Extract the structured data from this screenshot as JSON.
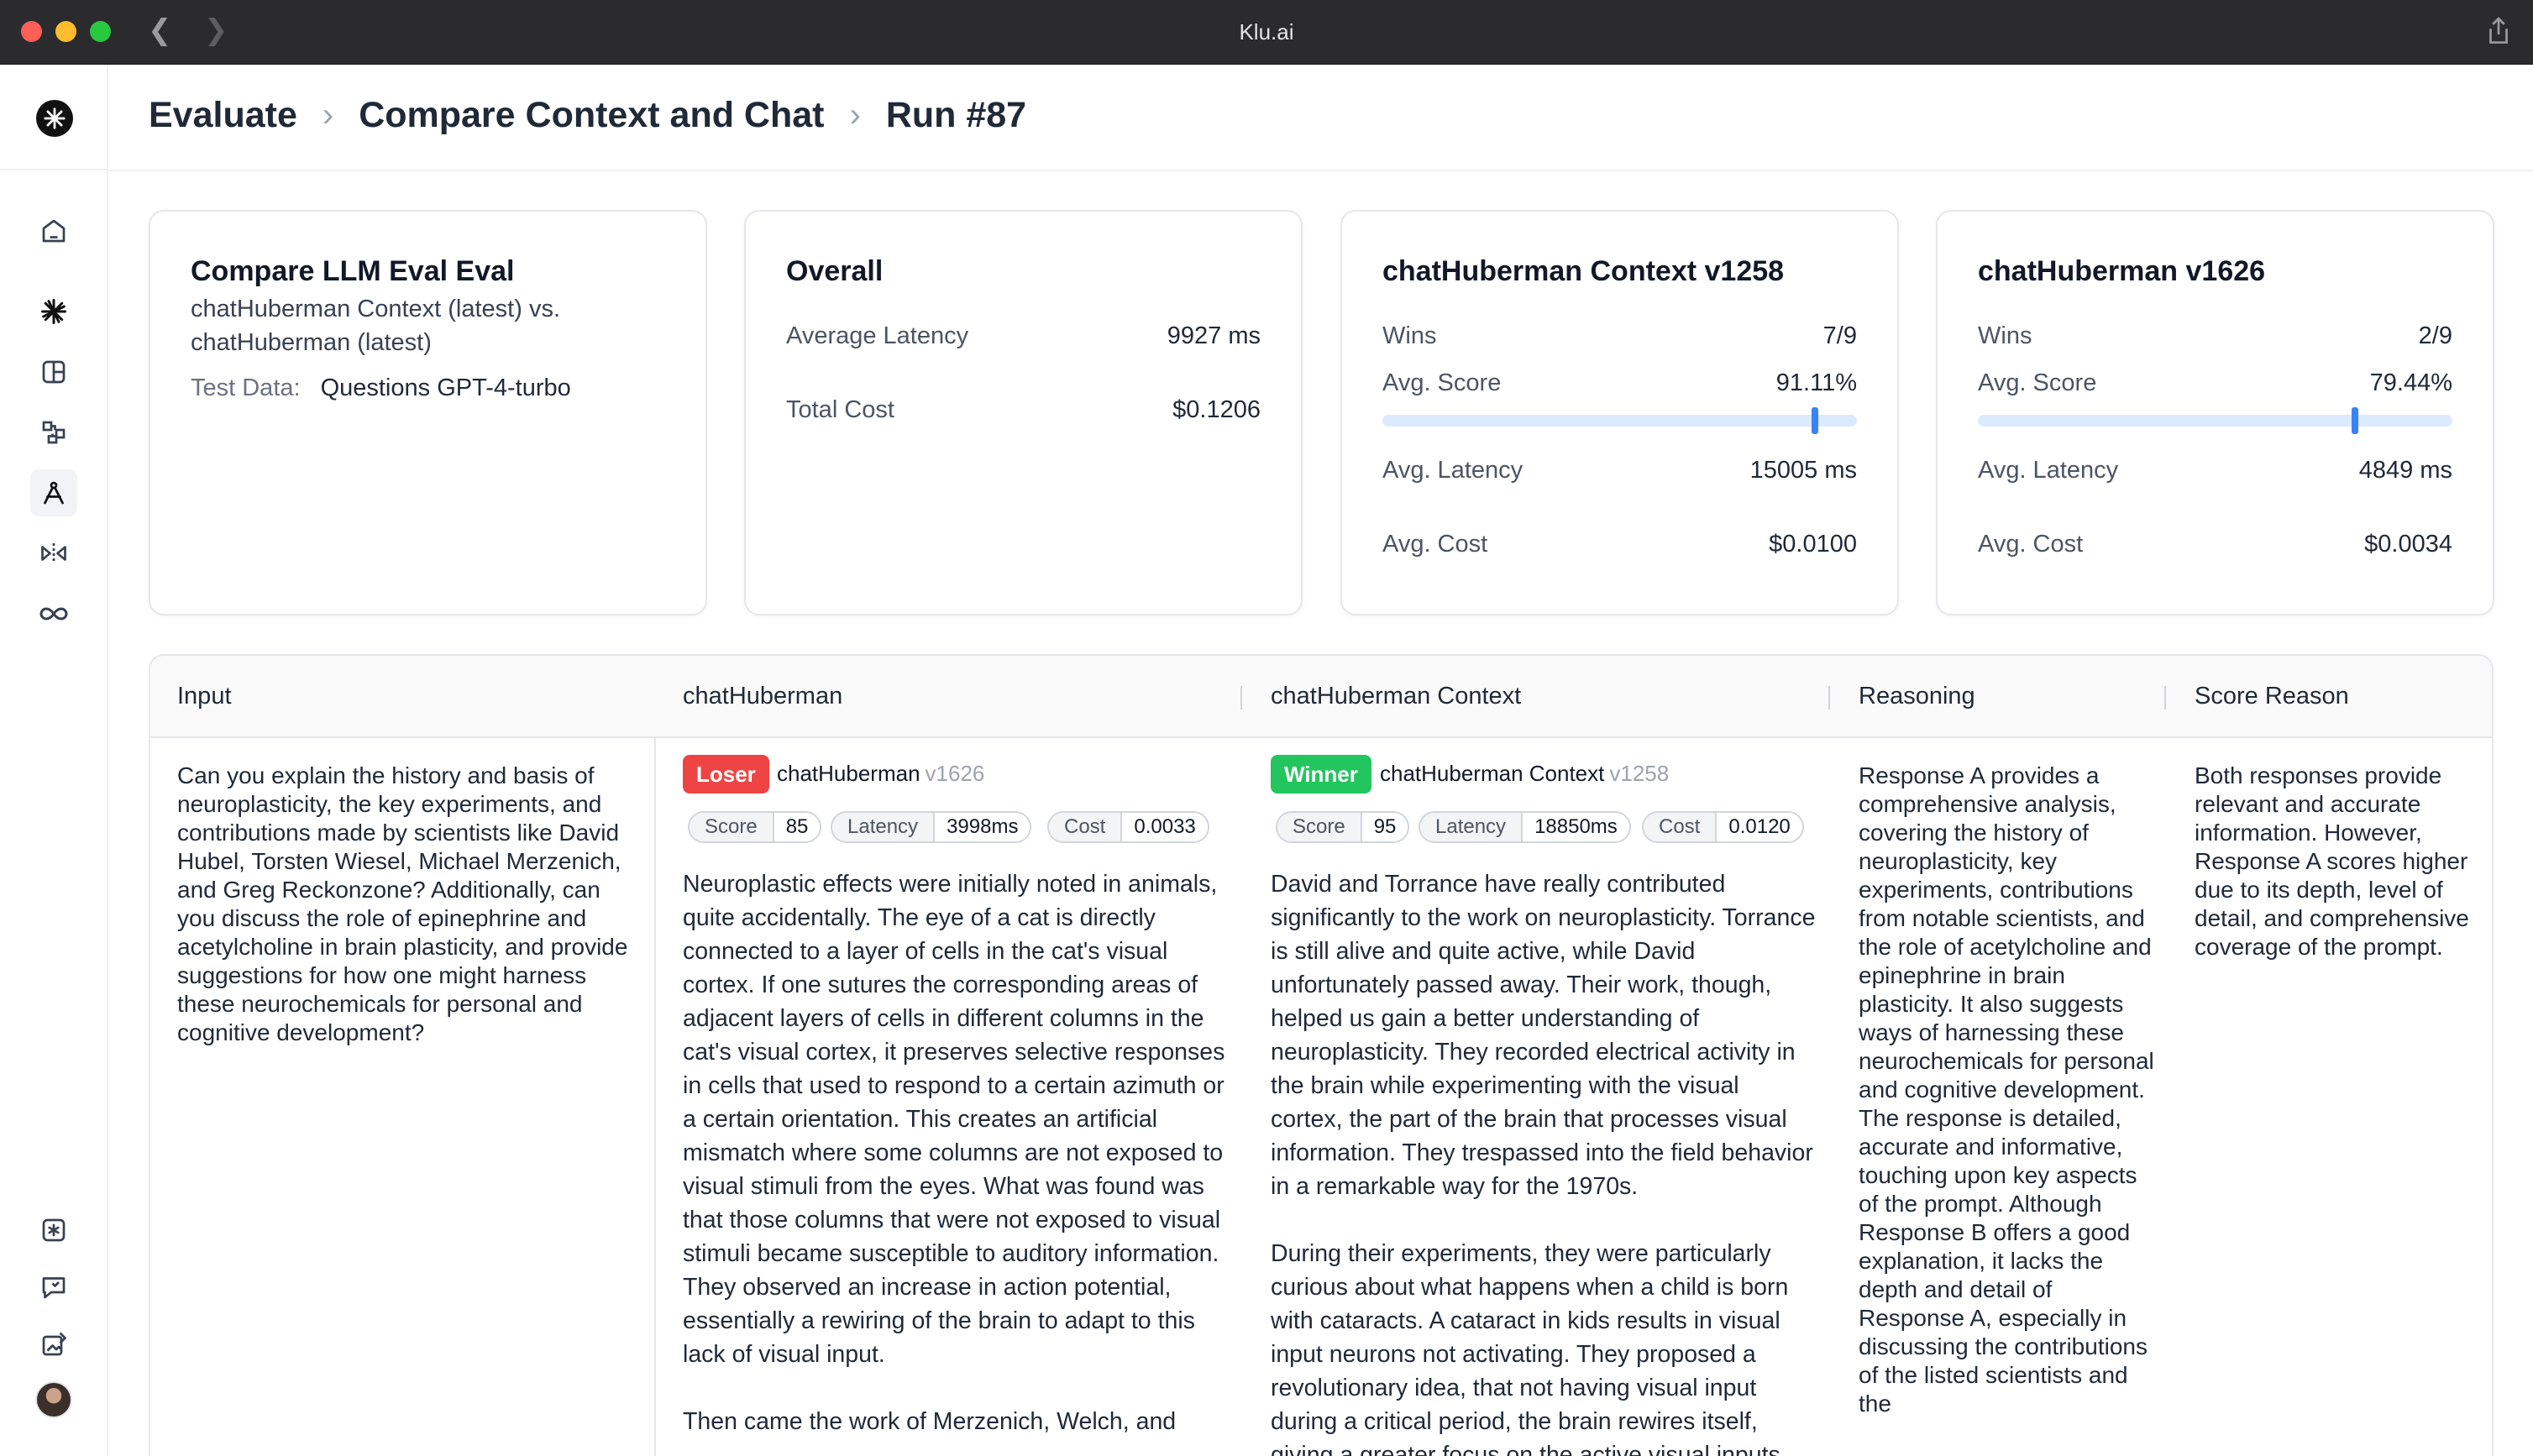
{
  "window": {
    "title": "Klu.ai"
  },
  "breadcrumb": [
    "Evaluate",
    "Compare Context and Chat",
    "Run #87"
  ],
  "cards": {
    "eval": {
      "title": "Compare LLM Eval Eval",
      "subtitle": "chatHuberman Context (latest) vs. chatHuberman (latest)",
      "test_data_label": "Test Data:",
      "test_data_value": "Questions GPT-4-turbo"
    },
    "overall": {
      "title": "Overall",
      "avg_latency_label": "Average Latency",
      "avg_latency_value": "9927 ms",
      "total_cost_label": "Total Cost",
      "total_cost_value": "$0.1206"
    },
    "context": {
      "title": "chatHuberman Context v1258",
      "wins_label": "Wins",
      "wins_value": "7/9",
      "score_label": "Avg. Score",
      "score_value": "91.11%",
      "score_fraction": 0.9111,
      "latency_label": "Avg. Latency",
      "latency_value": "15005 ms",
      "cost_label": "Avg. Cost",
      "cost_value": "$0.0100"
    },
    "chat": {
      "title": "chatHuberman v1626",
      "wins_label": "Wins",
      "wins_value": "2/9",
      "score_label": "Avg. Score",
      "score_value": "79.44%",
      "score_fraction": 0.7944,
      "latency_label": "Avg. Latency",
      "latency_value": "4849 ms",
      "cost_label": "Avg. Cost",
      "cost_value": "$0.0034"
    }
  },
  "table": {
    "headers": [
      "Input",
      "chatHuberman",
      "chatHuberman Context",
      "Reasoning",
      "Score Reason"
    ],
    "row": {
      "input": "Can you explain the history and basis of neuroplasticity, the key experiments, and contributions made by scientists like David Hubel, Torsten Wiesel, Michael Merzenich, and Greg Reckonzone? Additionally, can you discuss the role of epinephrine and acetylcholine in brain plasticity, and provide suggestions for how one might harness these neurochemicals for personal and cognitive development?",
      "chat": {
        "badge": "Loser",
        "model": "chatHuberman",
        "version": "v1626",
        "score_label": "Score",
        "score": "85",
        "latency_label": "Latency",
        "latency": "3998ms",
        "cost_label": "Cost",
        "cost": "0.0033",
        "response_p1": "Neuroplastic effects were initially noted in animals, quite accidentally. The eye of a cat is directly connected to a layer of cells in the cat's visual cortex. If one sutures the corresponding areas of adjacent layers of cells in different columns in the cat's visual cortex, it preserves selective responses in cells that used to respond to a certain azimuth or a certain orientation. This creates an artificial mismatch where some columns are not exposed to visual stimuli from the eyes. What was found was that those columns that were not exposed to visual stimuli became susceptible to auditory information. They observed an increase in action potential, essentially a rewiring of the brain to adapt to this lack of visual input.",
        "response_p2": "Then came the work of Merzenich, Welch, and"
      },
      "context": {
        "badge": "Winner",
        "model": "chatHuberman Context",
        "version": "v1258",
        "score_label": "Score",
        "score": "95",
        "latency_label": "Latency",
        "latency": "18850ms",
        "cost_label": "Cost",
        "cost": "0.0120",
        "response_p1": "David and Torrance have really contributed significantly to the work on neuroplasticity. Torrance is still alive and quite active, while David unfortunately passed away. Their work, though, helped us gain a better understanding of neuroplasticity. They recorded electrical activity in the brain while experimenting with the visual cortex, the part of the brain that processes visual information. They trespassed into the field behavior in a remarkable way for the 1970s.",
        "response_p2": "During their experiments, they were particularly curious about what happens when a child is born with cataracts. A cataract in kids results in visual input neurons not activating. They proposed a revolutionary idea, that not having visual input during a critical period, the brain rewires itself, giving a greater focus on the active visual inputs"
      },
      "reasoning": "Response A provides a comprehensive analysis, covering the history of neuroplasticity, key experiments, contributions from notable scientists, and the role of acetylcholine and epinephrine in brain plasticity. It also suggests ways of harnessing these neurochemicals for personal and cognitive development. The response is detailed, accurate and informative, touching upon key aspects of the prompt. Although Response B offers a good explanation, it lacks the depth and detail of Response A, especially in discussing the contributions of the listed scientists and the",
      "score_reason": "Both responses provide relevant and accurate information. However, Response A scores higher due to its depth, level of detail, and comprehensive coverage of the prompt."
    }
  },
  "icons": [
    "back-arrow-icon",
    "forward-arrow-icon",
    "share-icon",
    "klu-logo-icon",
    "home-icon",
    "spark-icon",
    "layout-icon",
    "workflow-icon",
    "evaluate-icon",
    "compare-icon",
    "infinity-icon",
    "asterisk-icon",
    "feedback-icon",
    "image-edit-icon"
  ],
  "colors": {
    "loser": "#ef4444",
    "winner": "#22c55e",
    "accent": "#3b82f6"
  }
}
